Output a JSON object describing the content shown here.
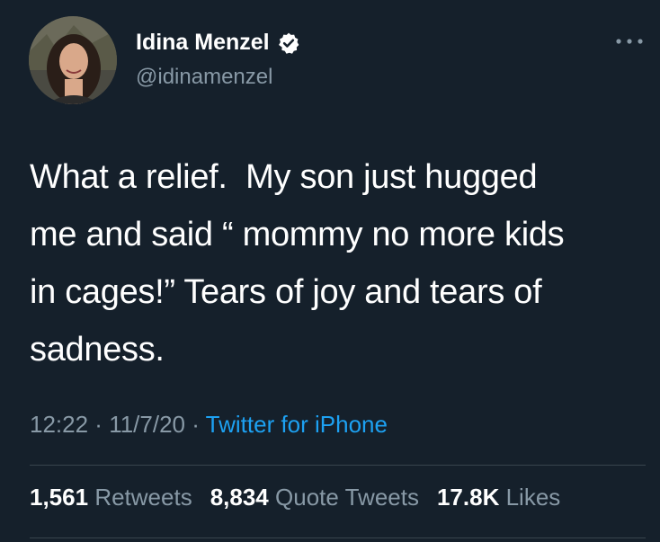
{
  "author": {
    "display_name": "Idina Menzel",
    "handle": "@idinamenzel",
    "verified_icon": "verified-badge-icon",
    "avatar_icon": "profile-photo"
  },
  "menu": {
    "icon": "more-options-icon"
  },
  "tweet": {
    "lines": [
      "What a relief.  My son just hugged",
      "me and said “ mommy no more kids",
      "in cages!” Tears of joy and tears of",
      "sadness."
    ]
  },
  "meta": {
    "time": "12:22",
    "separator": " · ",
    "date": "11/7/20",
    "source": "Twitter for iPhone"
  },
  "stats": {
    "retweets_count": "1,561",
    "retweets_label": "Retweets",
    "quotes_count": "8,834",
    "quotes_label": "Quote Tweets",
    "likes_count": "17.8K",
    "likes_label": "Likes"
  },
  "colors": {
    "background": "#15202b",
    "primary_text": "#ffffff",
    "secondary_text": "#8899a6",
    "link": "#1da1f2",
    "divider": "#38444d"
  }
}
